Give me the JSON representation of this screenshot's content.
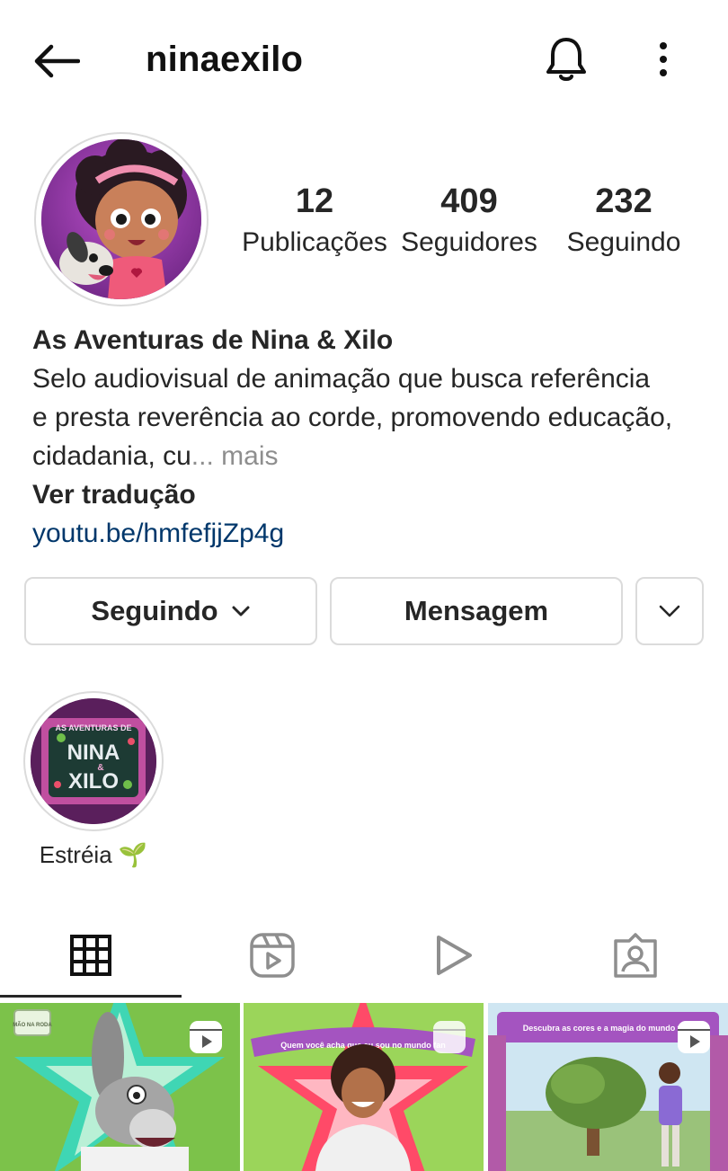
{
  "header": {
    "username": "ninaexilo"
  },
  "icons": {
    "back": "arrow-left-icon",
    "notifications": "bell-icon",
    "more": "more-vertical-icon"
  },
  "stats": {
    "posts": {
      "value": "12",
      "label": "Publicações"
    },
    "followers": {
      "value": "409",
      "label": "Seguidores"
    },
    "following": {
      "value": "232",
      "label": "Seguindo"
    }
  },
  "bio": {
    "name": "As Aventuras de Nina & Xilo",
    "line1": "Selo audiovisual de animação que busca referência",
    "line2": "e presta reverência ao corde, promovendo educação,",
    "line3": "cidadania, cu",
    "ellipsis": "...",
    "more": " mais",
    "translate": "Ver tradução",
    "link": "youtu.be/hmfefjjZp4g"
  },
  "buttons": {
    "following": "Seguindo",
    "message": "Mensagem"
  },
  "highlights": [
    {
      "label": "Estréia 🌱",
      "cover_text_top": "AS AVENTURAS DE",
      "cover_text_main1": "NINA",
      "cover_text_amp": "&",
      "cover_text_main2": "XILO"
    }
  ],
  "tabs": [
    {
      "name": "posts-grid",
      "icon": "grid-icon",
      "active": true
    },
    {
      "name": "reels",
      "icon": "reels-icon",
      "active": false
    },
    {
      "name": "videos",
      "icon": "play-icon",
      "active": false
    },
    {
      "name": "tagged",
      "icon": "tagged-person-icon",
      "active": false
    }
  ],
  "posts": [
    {
      "type": "reel",
      "badge": "MÃO NA RODA"
    },
    {
      "type": "reel",
      "caption": "Quem você acha que eu sou no mundo fan"
    },
    {
      "type": "reel",
      "caption": "Descubra as cores e a magia do mundo fant"
    }
  ],
  "colors": {
    "link": "#00376b",
    "border": "#dbdbdb",
    "text": "#262626",
    "muted": "#8e8e8e"
  }
}
